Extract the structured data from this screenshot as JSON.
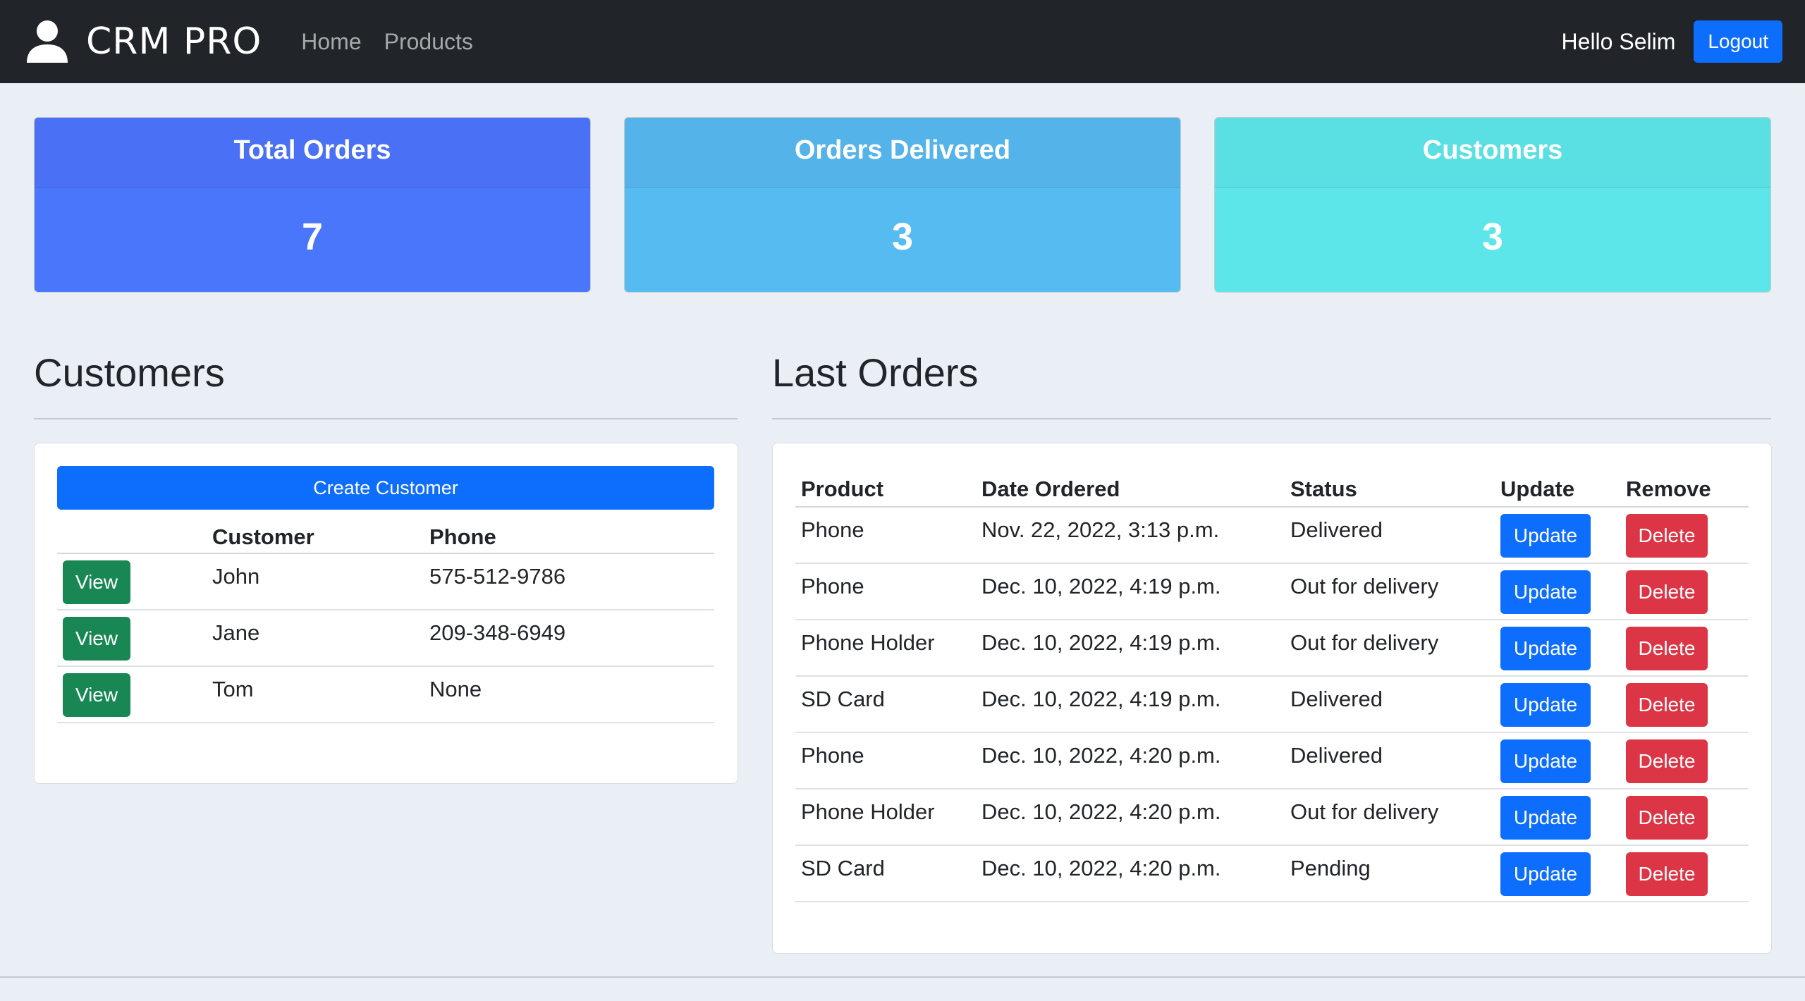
{
  "navbar": {
    "brand": "CRM PRO",
    "links": [
      "Home",
      "Products"
    ],
    "greeting": "Hello Selim",
    "logout_label": "Logout"
  },
  "stats": [
    {
      "label": "Total Orders",
      "value": "7"
    },
    {
      "label": "Orders Delivered",
      "value": "3"
    },
    {
      "label": "Customers",
      "value": "3"
    }
  ],
  "customers": {
    "title": "Customers",
    "create_label": "Create Customer",
    "columns": [
      "",
      "Customer",
      "Phone"
    ],
    "view_label": "View",
    "rows": [
      {
        "name": "John",
        "phone": "575-512-9786"
      },
      {
        "name": "Jane",
        "phone": "209-348-6949"
      },
      {
        "name": "Tom",
        "phone": "None"
      }
    ]
  },
  "orders": {
    "title": "Last Orders",
    "columns": [
      "Product",
      "Date Ordered",
      "Status",
      "Update",
      "Remove"
    ],
    "update_label": "Update",
    "delete_label": "Delete",
    "rows": [
      {
        "product": "Phone",
        "date": "Nov. 22, 2022, 3:13 p.m.",
        "status": "Delivered"
      },
      {
        "product": "Phone",
        "date": "Dec. 10, 2022, 4:19 p.m.",
        "status": "Out for delivery"
      },
      {
        "product": "Phone Holder",
        "date": "Dec. 10, 2022, 4:19 p.m.",
        "status": "Out for delivery"
      },
      {
        "product": "SD Card",
        "date": "Dec. 10, 2022, 4:19 p.m.",
        "status": "Delivered"
      },
      {
        "product": "Phone",
        "date": "Dec. 10, 2022, 4:20 p.m.",
        "status": "Delivered"
      },
      {
        "product": "Phone Holder",
        "date": "Dec. 10, 2022, 4:20 p.m.",
        "status": "Out for delivery"
      },
      {
        "product": "SD Card",
        "date": "Dec. 10, 2022, 4:20 p.m.",
        "status": "Pending"
      }
    ]
  },
  "colors": {
    "navbar": "#212529",
    "primary": "#0d6efd",
    "success": "#198754",
    "danger": "#dc3545",
    "card_total": "#4a76fc",
    "card_delivered": "#55bbf1",
    "card_customers": "#5ce6ea"
  },
  "icons": {
    "brand": "user-icon"
  }
}
